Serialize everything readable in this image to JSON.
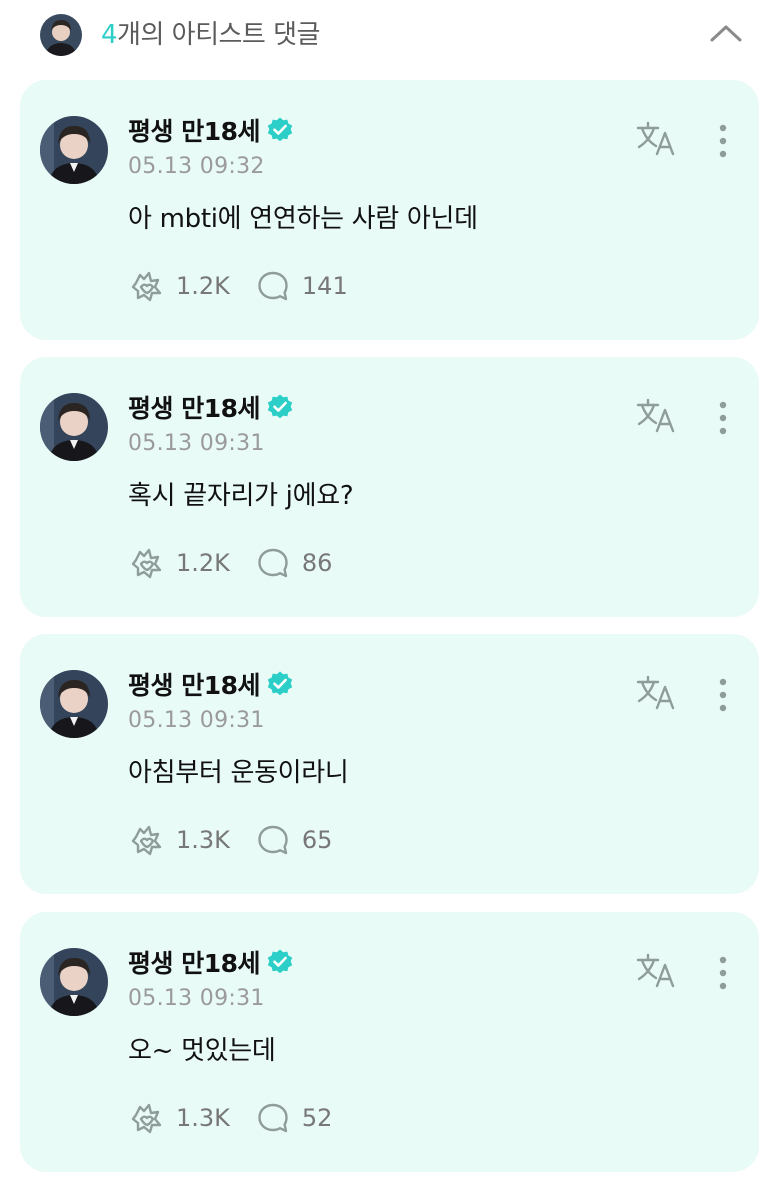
{
  "header": {
    "count": "4",
    "title_rest": "개의 아티스트 댓글"
  },
  "colors": {
    "accent": "#2ccfc7",
    "card_bg": "#e9fbf7",
    "icon_gray": "#8e9c9a"
  },
  "comments": [
    {
      "author": "평생 만18세",
      "timestamp": "05.13 09:32",
      "text": "아 mbti에 연연하는 사람 아닌데",
      "likes": "1.2K",
      "replies": "141"
    },
    {
      "author": "평생 만18세",
      "timestamp": "05.13 09:31",
      "text": "혹시 끝자리가 j에요?",
      "likes": "1.2K",
      "replies": "86"
    },
    {
      "author": "평생 만18세",
      "timestamp": "05.13 09:31",
      "text": "아침부터 운동이라니",
      "likes": "1.3K",
      "replies": "65"
    },
    {
      "author": "평생 만18세",
      "timestamp": "05.13 09:31",
      "text": "오~ 멋있는데",
      "likes": "1.3K",
      "replies": "52"
    }
  ]
}
